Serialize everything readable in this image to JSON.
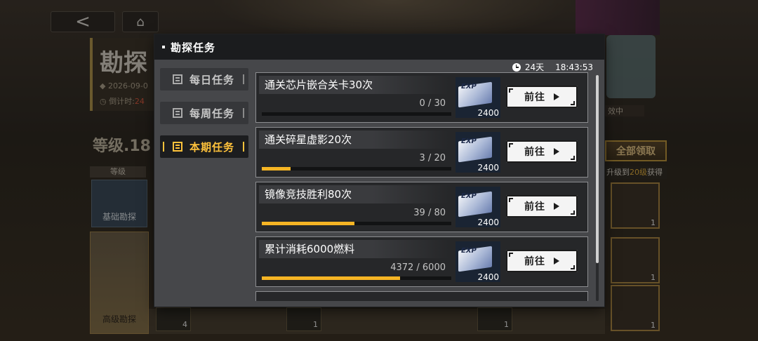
{
  "background": {
    "title": "勘探",
    "date": "2026-09-0",
    "countdown_label": "倒计时:",
    "countdown_value": "24",
    "level": "等级.18",
    "level_label": "等级",
    "basic_track": "基础勘探",
    "advanced_track": "高级勘探",
    "claim_all": "全部领取",
    "upgrade_prefix": "升级到",
    "upgrade_level": "20级",
    "upgrade_suffix": "获得",
    "status_text": "效中",
    "mini_qty_a": "4",
    "mini_qty_b": "1",
    "mini_qty_c": "1",
    "reward_qty": "1"
  },
  "modal": {
    "title": "勘探任务",
    "timer": {
      "days": "24天",
      "time": "18:43:53"
    },
    "tabs": [
      {
        "label": "每日任务",
        "active": false
      },
      {
        "label": "每周任务",
        "active": false
      },
      {
        "label": "本期任务",
        "active": true
      }
    ],
    "go_label": "前往",
    "tasks": [
      {
        "name": "通关芯片嵌合关卡30次",
        "progress_text": "0 / 30",
        "progress": 0.0,
        "reward_icon": "EXP",
        "reward_qty": "2400"
      },
      {
        "name": "通关碎星虚影20次",
        "progress_text": "3 / 20",
        "progress": 0.15,
        "reward_icon": "EXP",
        "reward_qty": "2400"
      },
      {
        "name": "镜像竞技胜利80次",
        "progress_text": "39 / 80",
        "progress": 0.4875,
        "reward_icon": "EXP",
        "reward_qty": "2400"
      },
      {
        "name": "累计消耗6000燃料",
        "progress_text": "4372 / 6000",
        "progress": 0.7287,
        "reward_icon": "EXP",
        "reward_qty": "2400"
      }
    ],
    "scroll_fraction": 0.83
  }
}
